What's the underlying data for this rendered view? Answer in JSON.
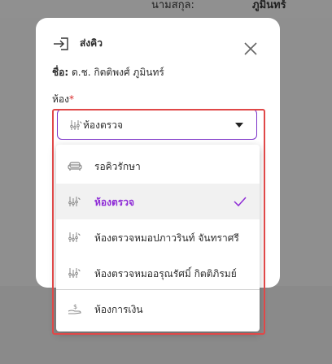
{
  "background": {
    "label": "นามสกุล:",
    "value": "ภูมินทร์"
  },
  "modal": {
    "title": "ส่งคิว",
    "title_icon": "login-arrow-icon",
    "close_icon": "close-icon",
    "patient_label": "ชื่อ:",
    "patient_name": "ด.ช. กิตติพงศ์ ภูมินทร์",
    "room_label": "ห้อง",
    "required_mark": "*",
    "room_select": {
      "value": "ห้องตรวจ",
      "icon": "stethoscope-icon"
    }
  },
  "dropdown": {
    "options": [
      {
        "label": "รอคิวรักษา",
        "icon": "sofa-icon",
        "selected": false
      },
      {
        "label": "ห้องตรวจ",
        "icon": "stethoscope-icon",
        "selected": true
      },
      {
        "label": "ห้องตรวจหมอปภาวรินท์ จันทราศรี",
        "icon": "stethoscope-icon",
        "selected": false
      },
      {
        "label": "ห้องตรวจหมออรุณรัศมิ์ กิตติภิรมย์",
        "icon": "stethoscope-icon",
        "selected": false
      },
      {
        "label": "ห้องการเงิน",
        "icon": "money-hand-icon",
        "selected": false
      }
    ]
  },
  "colors": {
    "accent": "#8e2bd6",
    "highlight_border": "#e04848",
    "required": "#d92b2b"
  }
}
